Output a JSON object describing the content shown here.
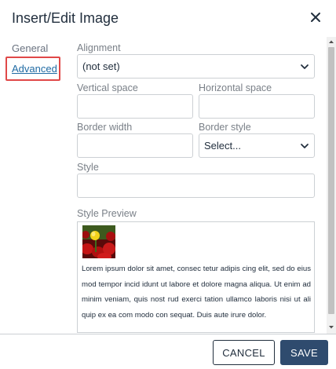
{
  "dialog": {
    "title": "Insert/Edit Image",
    "close_icon": "close-icon"
  },
  "nav": {
    "general_label": "General",
    "advanced_label": "Advanced",
    "active": "Advanced",
    "highlight_color": "#e04848"
  },
  "form": {
    "alignment": {
      "label": "Alignment",
      "value": "(not set)"
    },
    "vertical_space": {
      "label": "Vertical space",
      "value": ""
    },
    "horizontal_space": {
      "label": "Horizontal space",
      "value": ""
    },
    "border_width": {
      "label": "Border width",
      "value": ""
    },
    "border_style": {
      "label": "Border style",
      "value": "Select..."
    },
    "style": {
      "label": "Style",
      "value": ""
    },
    "style_preview": {
      "label": "Style Preview",
      "image_icon": "tulip-image",
      "text": "Lorem ipsum dolor sit amet, consec tetur adipis cing elit, sed do eius mod tempor incid idunt ut labore et dolore magna aliqua. Ut enim ad minim veniam, quis nost rud exerci tation ullamco laboris nisi ut ali quip ex ea com modo con sequat. Duis aute irure dolor."
    }
  },
  "footer": {
    "cancel_label": "CANCEL",
    "save_label": "SAVE",
    "primary_color": "#2f4b6e"
  }
}
